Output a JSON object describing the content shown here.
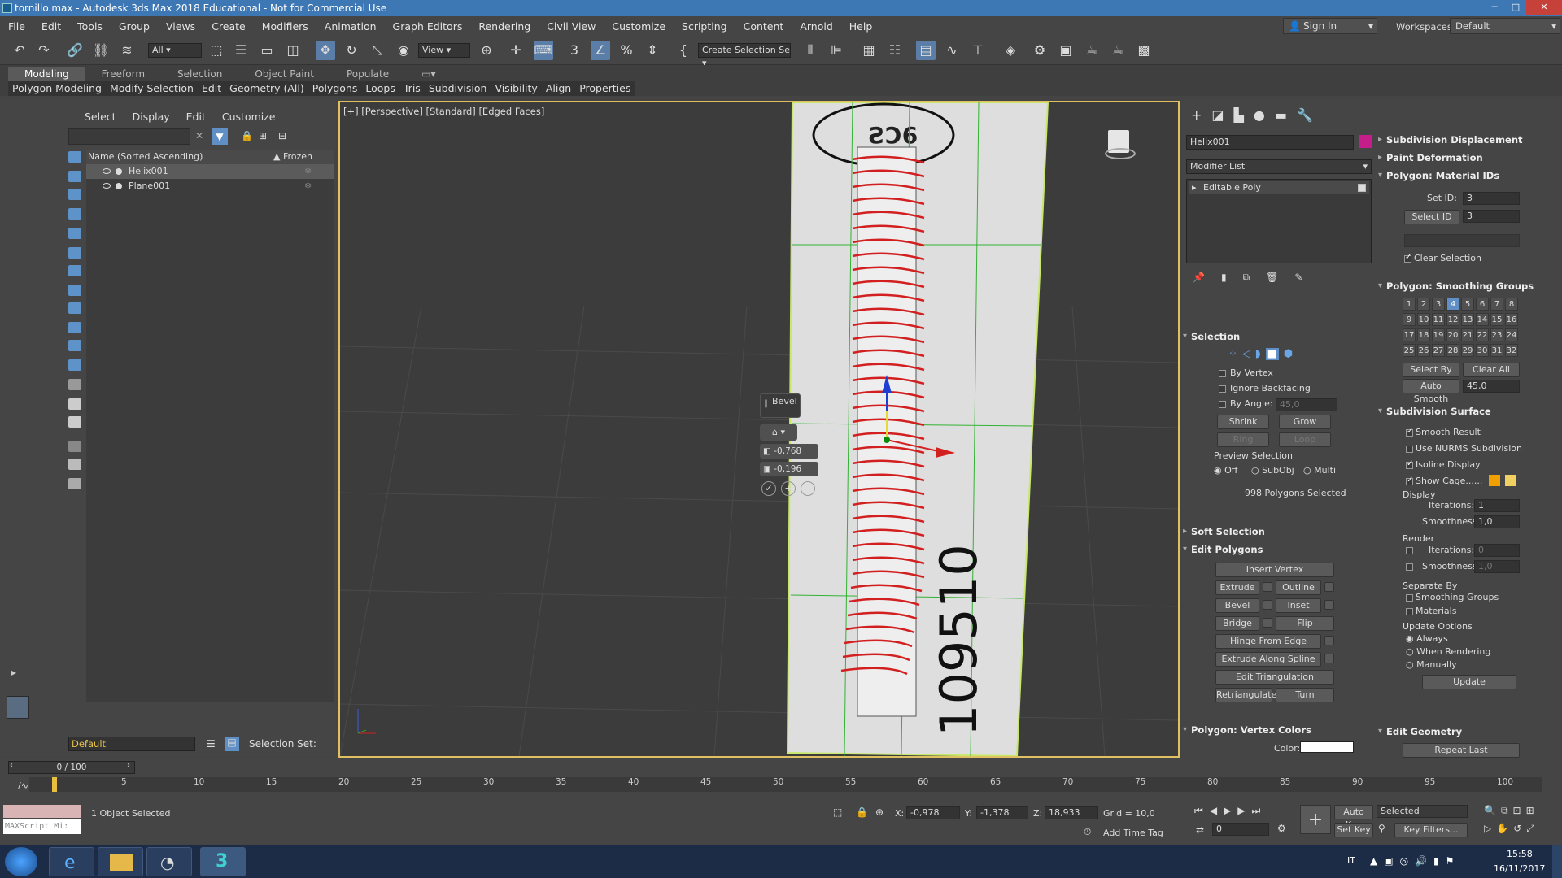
{
  "window": {
    "title": "tornillo.max - Autodesk 3ds Max 2018 Educational - Not for Commercial Use"
  },
  "menu": [
    "File",
    "Edit",
    "Tools",
    "Group",
    "Views",
    "Create",
    "Modifiers",
    "Animation",
    "Graph Editors",
    "Rendering",
    "Civil View",
    "Customize",
    "Scripting",
    "Content",
    "Arnold",
    "Help"
  ],
  "account": {
    "sign_in": "Sign In",
    "workspaces_label": "Workspaces:",
    "workspace": "Default"
  },
  "toolbar": {
    "filter": "All",
    "view": "View",
    "selection_set": "Create Selection Se"
  },
  "ribbon": {
    "tabs": [
      "Modeling",
      "Freeform",
      "Selection",
      "Object Paint",
      "Populate"
    ],
    "sub": [
      "Polygon Modeling",
      "Modify Selection",
      "Edit",
      "Geometry (All)",
      "Polygons",
      "Loops",
      "Tris",
      "Subdivision",
      "Visibility",
      "Align",
      "Properties"
    ]
  },
  "scene": {
    "menu": [
      "Select",
      "Display",
      "Edit",
      "Customize"
    ],
    "col_name": "Name (Sorted Ascending)",
    "col_frozen": "▲ Frozen",
    "items": [
      "Helix001",
      "Plane001"
    ],
    "layer": "Default",
    "selection_set": "Selection Set:"
  },
  "viewport": {
    "label": "[+] [Perspective] [Standard] [Edged Faces]",
    "caddy_title": "Bevel",
    "caddy_height": "-0,768",
    "caddy_outline": "-0,196",
    "photo_text": "109510",
    "axis_x": "x"
  },
  "command": {
    "object_name": "Helix001",
    "modifier_list": "Modifier List",
    "stack_item": "Editable Poly",
    "selection": {
      "title": "Selection",
      "by_vertex": "By Vertex",
      "ignore_backfacing": "Ignore Backfacing",
      "by_angle": "By Angle:",
      "angle": "45,0",
      "shrink": "Shrink",
      "grow": "Grow",
      "ring": "Ring",
      "loop": "Loop",
      "preview": "Preview Selection",
      "off": "Off",
      "subobj": "SubObj",
      "multi": "Multi",
      "status": "998 Polygons Selected"
    },
    "soft_selection": "Soft Selection",
    "edit_polygons": {
      "title": "Edit Polygons",
      "insert_vertex": "Insert Vertex",
      "extrude": "Extrude",
      "outline": "Outline",
      "bevel": "Bevel",
      "inset": "Inset",
      "bridge": "Bridge",
      "flip": "Flip",
      "hinge": "Hinge From Edge",
      "extrude_spline": "Extrude Along Spline",
      "edit_tri": "Edit Triangulation",
      "retri": "Retriangulate",
      "turn": "Turn"
    },
    "vertex_colors": {
      "title": "Polygon: Vertex Colors",
      "color": "Color:"
    }
  },
  "rollouts": {
    "subdiv_disp": "Subdivision Displacement",
    "paint_def": "Paint Deformation",
    "mat_ids": {
      "title": "Polygon: Material IDs",
      "set_id": "Set ID:",
      "set_val": "3",
      "select_id": "Select ID",
      "select_val": "3",
      "clear_sel": "Clear Selection"
    },
    "smoothing": {
      "title": "Polygon: Smoothing Groups",
      "groups": [
        "1",
        "2",
        "3",
        "4",
        "5",
        "6",
        "7",
        "8",
        "9",
        "10",
        "11",
        "12",
        "13",
        "14",
        "15",
        "16",
        "17",
        "18",
        "19",
        "20",
        "21",
        "22",
        "23",
        "24",
        "25",
        "26",
        "27",
        "28",
        "29",
        "30",
        "31",
        "32"
      ],
      "active": "4",
      "select_by": "Select By SG",
      "clear_all": "Clear All",
      "auto_smooth": "Auto Smooth",
      "auto_val": "45,0"
    },
    "subdiv_surface": {
      "title": "Subdivision Surface",
      "smooth_result": "Smooth Result",
      "nurms": "Use NURMS Subdivision",
      "isoline": "Isoline Display",
      "show_cage": "Show Cage......",
      "display": "Display",
      "iterations": "Iterations:",
      "iter_val": "1",
      "smoothness": "Smoothness:",
      "smooth_val": "1,0",
      "render": "Render",
      "r_iter_val": "0",
      "r_smooth_val": "1,0",
      "separate_by": "Separate By",
      "sep_sg": "Smoothing Groups",
      "sep_mat": "Materials",
      "update_options": "Update Options",
      "always": "Always",
      "when_rendering": "When Rendering",
      "manually": "Manually",
      "update": "Update"
    },
    "edit_geometry": {
      "title": "Edit Geometry",
      "repeat_last": "Repeat Last"
    }
  },
  "timeline": {
    "frame": "0 / 100",
    "ticks": [
      "5",
      "10",
      "15",
      "20",
      "25",
      "30",
      "35",
      "40",
      "45",
      "50",
      "55",
      "60",
      "65",
      "70",
      "75",
      "80",
      "85",
      "90",
      "95",
      "100"
    ]
  },
  "status": {
    "maxscript": "MAXScript Mi:",
    "selected": "1 Object Selected",
    "x_label": "X:",
    "x": "-0,978",
    "y_label": "Y:",
    "y": "-1,378",
    "z_label": "Z:",
    "z": "18,933",
    "grid": "Grid = 10,0",
    "add_time_tag": "Add Time Tag",
    "auto_key": "Auto Key",
    "set_key": "Set Key",
    "key_mode": "Selected",
    "key_filters": "Key Filters...",
    "frame_val": "0"
  },
  "taskbar": {
    "lang": "IT",
    "time": "15:58",
    "date": "16/11/2017"
  },
  "colors": {
    "title_bar": "#3d78b5",
    "selection_red": "#d22020",
    "grid_green": "#4caf4c",
    "accent_blue": "#5f8fc4",
    "object_color": "#c51e8a"
  }
}
